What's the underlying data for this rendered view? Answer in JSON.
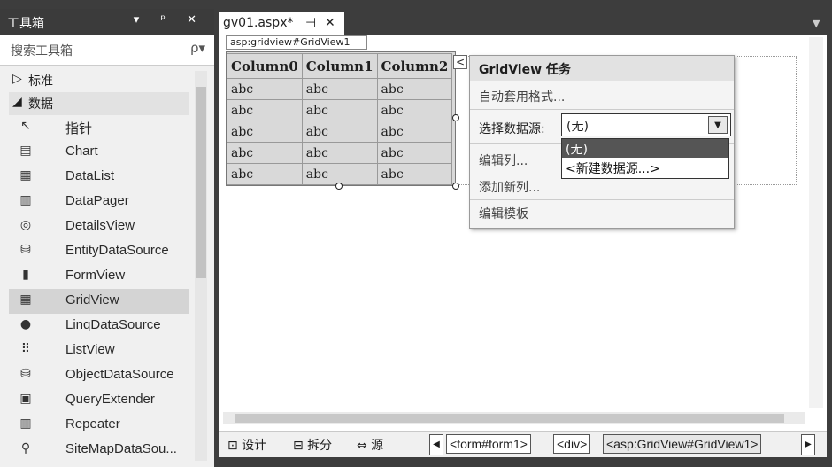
{
  "toolbox": {
    "title": "工具箱",
    "title_buttons": "▾ ᵖ ✕",
    "search_placeholder": "搜索工具箱",
    "search_icon": "ρ▾",
    "group_standard": "标准",
    "group_data": "数据",
    "items": [
      {
        "icon": "↖",
        "label": "指针"
      },
      {
        "icon": "▤",
        "label": "Chart"
      },
      {
        "icon": "▦",
        "label": "DataList"
      },
      {
        "icon": "▥",
        "label": "DataPager"
      },
      {
        "icon": "◎",
        "label": "DetailsView"
      },
      {
        "icon": "⛁",
        "label": "EntityDataSource"
      },
      {
        "icon": "▮",
        "label": "FormView"
      },
      {
        "icon": "▦",
        "label": "GridView"
      },
      {
        "icon": "●",
        "label": "LinqDataSource"
      },
      {
        "icon": "⠿",
        "label": "ListView"
      },
      {
        "icon": "⛁",
        "label": "ObjectDataSource"
      },
      {
        "icon": "▣",
        "label": "QueryExtender"
      },
      {
        "icon": "▥",
        "label": "Repeater"
      },
      {
        "icon": "⚲",
        "label": "SiteMapDataSou..."
      }
    ]
  },
  "editor": {
    "tab_name": "gv01.aspx*",
    "tab_pin": "⊣",
    "tab_close": "✕",
    "control_label": "asp:gridview#GridView1",
    "grid": {
      "columns": [
        "Column0",
        "Column1",
        "Column2"
      ],
      "rows": [
        [
          "abc",
          "abc",
          "abc"
        ],
        [
          "abc",
          "abc",
          "abc"
        ],
        [
          "abc",
          "abc",
          "abc"
        ],
        [
          "abc",
          "abc",
          "abc"
        ],
        [
          "abc",
          "abc",
          "abc"
        ]
      ]
    },
    "smart_tag_glyph": "<",
    "tasks": {
      "title": "GridView 任务",
      "auto_format": "自动套用格式...",
      "choose_ds_label": "选择数据源:",
      "choose_ds_value": "(无)",
      "dropdown_arrow": "▼",
      "ds_options": [
        "(无)",
        "<新建数据源...>"
      ],
      "edit_columns": "编辑列...",
      "add_column": "添加新列...",
      "edit_templates": "编辑模板"
    }
  },
  "bottombar": {
    "design": "⊡ 设计",
    "split": "⊟ 拆分",
    "source": "⇔ 源",
    "crumbs": [
      "<form#form1>",
      "<div>",
      "<asp:GridView#GridView1>"
    ],
    "left_arrow": "◀",
    "right_arrow": "▶"
  },
  "colors": {
    "titlebar": "#3b3b3b",
    "selected": "#d4d4d4",
    "accent_option": "#555555"
  }
}
